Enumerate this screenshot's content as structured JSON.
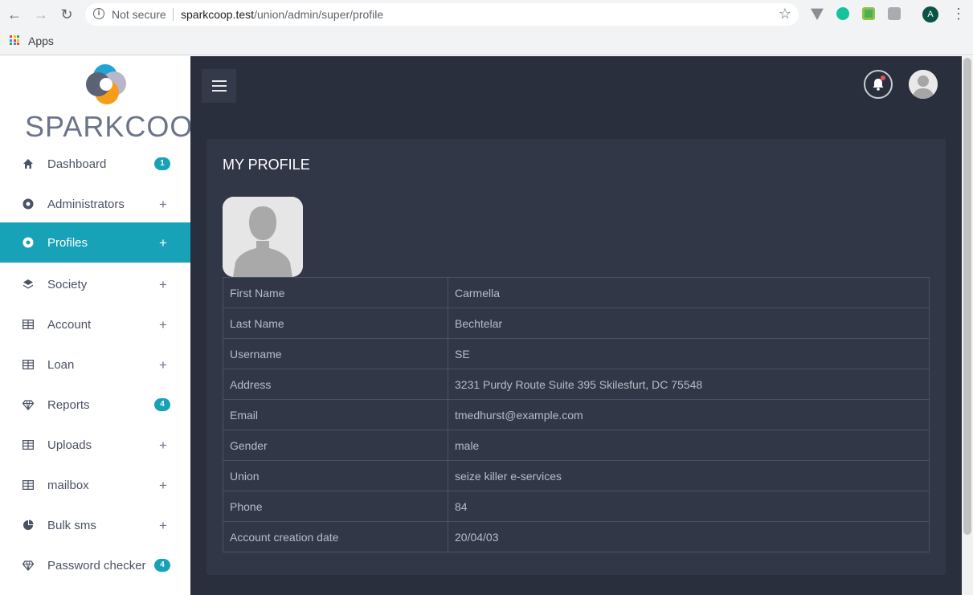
{
  "browser": {
    "security_label": "Not secure",
    "url_domain": "sparkcoop.test",
    "url_path": "/union/admin/super/profile",
    "profile_initial": "A",
    "bookmarks_apps_label": "Apps"
  },
  "sidebar": {
    "brand": "SPARKCOOP",
    "items": [
      {
        "label": "Dashboard",
        "icon": "home-icon",
        "badge": "1"
      },
      {
        "label": "Administrators",
        "icon": "circle-dot-icon",
        "expand": "+"
      },
      {
        "label": "Profiles",
        "icon": "circle-dot-icon",
        "expand": "+",
        "active": true
      },
      {
        "label": "Society",
        "icon": "layers-icon",
        "expand": "+"
      },
      {
        "label": "Account",
        "icon": "grid-icon",
        "expand": "+"
      },
      {
        "label": "Loan",
        "icon": "grid-icon",
        "expand": "+"
      },
      {
        "label": "Reports",
        "icon": "diamond-icon",
        "badge": "4"
      },
      {
        "label": "Uploads",
        "icon": "grid-icon",
        "expand": "+"
      },
      {
        "label": "mailbox",
        "icon": "grid-icon",
        "expand": "+"
      },
      {
        "label": "Bulk sms",
        "icon": "pie-chart-icon",
        "expand": "+"
      },
      {
        "label": "Password checker",
        "icon": "diamond-icon",
        "badge": "4"
      }
    ]
  },
  "main": {
    "page_title": "MY PROFILE",
    "profile": [
      {
        "label": "First Name",
        "value": "Carmella"
      },
      {
        "label": "Last Name",
        "value": "Bechtelar"
      },
      {
        "label": "Username",
        "value": "SE"
      },
      {
        "label": "Address",
        "value": "3231 Purdy Route Suite 395 Skilesfurt, DC 75548"
      },
      {
        "label": "Email",
        "value": "tmedhurst@example.com"
      },
      {
        "label": "Gender",
        "value": "male"
      },
      {
        "label": "Union",
        "value": "seize killer e-services"
      },
      {
        "label": "Phone",
        "value": "84"
      },
      {
        "label": "Account creation date",
        "value": "20/04/03"
      }
    ]
  },
  "colors": {
    "accent": "#17a2b8",
    "main_bg": "#2a2f3d",
    "card_bg": "#323748"
  }
}
